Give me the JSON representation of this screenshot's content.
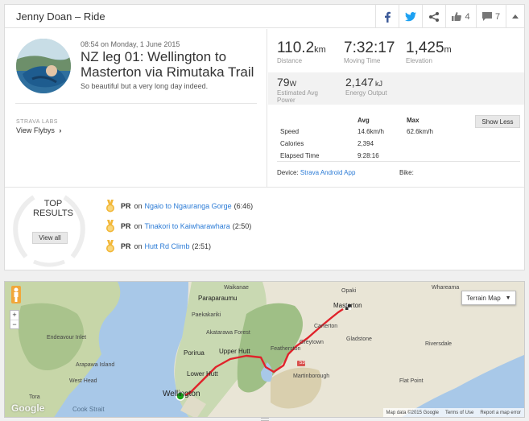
{
  "header": {
    "title": "Jenny Doan – Ride",
    "kudos_count": "4",
    "comments_count": "7"
  },
  "activity": {
    "timestamp": "08:54 on Monday, 1 June 2015",
    "title": "NZ leg 01: Wellington to Masterton via Rimutaka Trail",
    "description": "So beautiful but a very long day indeed.",
    "labs_label": "STRAVA LABS",
    "flybys_label": "View Flybys"
  },
  "stats": {
    "distance_value": "110.2",
    "distance_unit": "km",
    "distance_label": "Distance",
    "moving_time_value": "7:32:17",
    "moving_time_label": "Moving Time",
    "elevation_value": "1,425",
    "elevation_unit": "m",
    "elevation_label": "Elevation",
    "power_value": "79",
    "power_unit": "W",
    "power_label": "Estimated Avg Power",
    "energy_value": "2,147",
    "energy_unit": "kJ",
    "energy_label": "Energy Output"
  },
  "details": {
    "col_avg": "Avg",
    "col_max": "Max",
    "rows": [
      {
        "label": "Speed",
        "avg": "14.6km/h",
        "max": "62.6km/h"
      },
      {
        "label": "Calories",
        "avg": "2,394",
        "max": ""
      },
      {
        "label": "Elapsed Time",
        "avg": "9:28:16",
        "max": ""
      }
    ],
    "show_less_label": "Show Less",
    "device_label": "Device:",
    "device_value": "Strava Android App",
    "bike_label": "Bike:"
  },
  "results": {
    "heading_line1": "TOP",
    "heading_line2": "RESULTS",
    "view_all_label": "View all",
    "items": [
      {
        "badge": "PR",
        "prefix": "on",
        "segment": "Ngaio to Ngauranga Gorge",
        "time": "(6:46)"
      },
      {
        "badge": "PR",
        "prefix": "on",
        "segment": "Tinakori to Kaiwharawhara",
        "time": "(2:50)"
      },
      {
        "badge": "PR",
        "prefix": "on",
        "segment": "Hutt Rd Climb",
        "time": "(2:51)"
      }
    ]
  },
  "map": {
    "terrain_label": "Terrain Map",
    "zoom_in": "+",
    "zoom_out": "−",
    "logo": "Google",
    "attribution": "Map data ©2015 Google",
    "terms": "Terms of Use",
    "report": "Report a map error",
    "places": [
      "Waikanae",
      "Paraparaumu",
      "Paekakariki",
      "Akatarawa Forest",
      "Porirua",
      "Upper Hutt",
      "Lower Hutt",
      "Wellington",
      "Featherston",
      "Greytown",
      "Carterton",
      "Masterton",
      "Opaki",
      "Whareama",
      "Gladstone",
      "Riversdale",
      "Martinborough",
      "Flat Point",
      "Arapawa Island",
      "West Head",
      "Cook Strait",
      "Endeavour Inlet",
      "Tora"
    ],
    "road_number": "53",
    "colors": {
      "route": "#e0232b",
      "start": "#1aa31a",
      "sea": "#a8c8e8"
    }
  },
  "colors": {
    "link": "#2b7bd6",
    "facebook": "#3b5998",
    "twitter": "#1da1f2"
  }
}
